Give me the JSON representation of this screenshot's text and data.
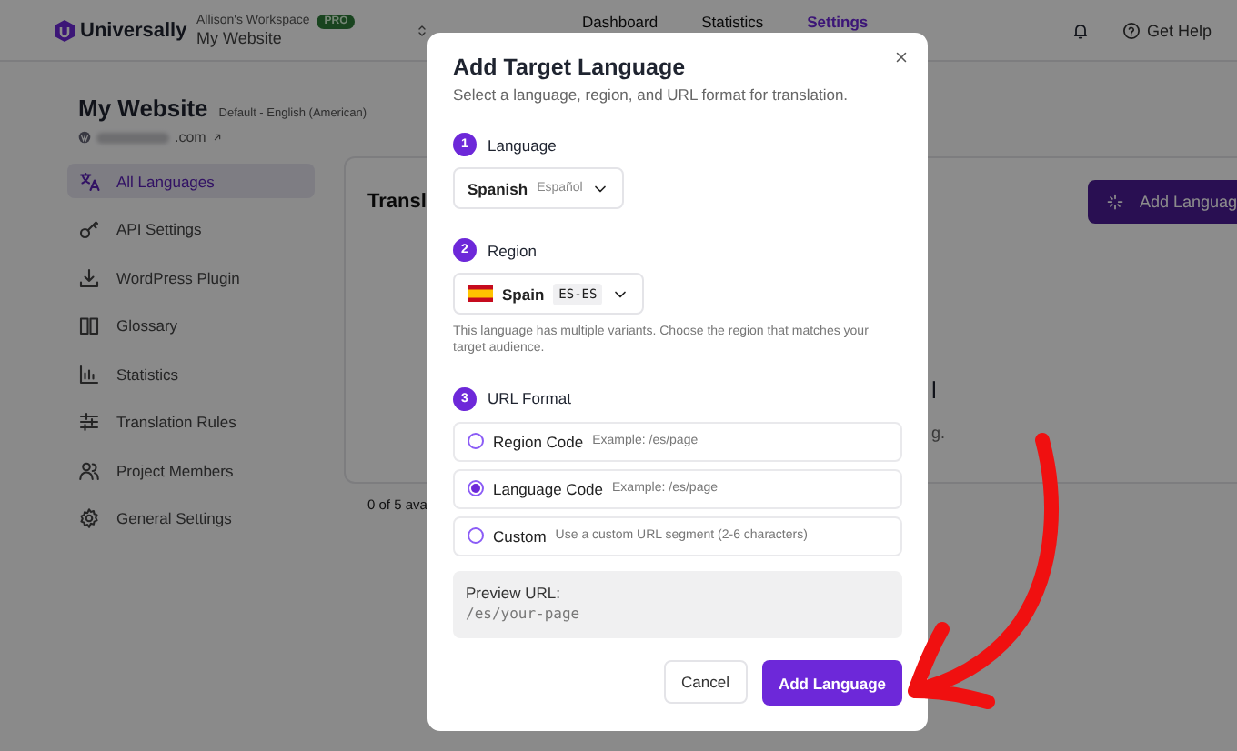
{
  "header": {
    "brand": "Universally",
    "workspace": "Allison's Workspace",
    "badge": "PRO",
    "site": "My Website",
    "help": "Get Help",
    "nav": [
      {
        "label": "Dashboard",
        "selected": false
      },
      {
        "label": "Statistics",
        "selected": false
      },
      {
        "label": "Settings",
        "selected": true
      }
    ]
  },
  "site": {
    "title": "My Website",
    "default_language": "Default - English (American)",
    "domain": ".com"
  },
  "sidebar": {
    "items": [
      {
        "label": "All Languages",
        "selected": true
      },
      {
        "label": "API Settings",
        "selected": false
      },
      {
        "label": "WordPress Plugin",
        "selected": false
      },
      {
        "label": "Glossary",
        "selected": false
      },
      {
        "label": "Statistics",
        "selected": false
      },
      {
        "label": "Translation Rules",
        "selected": false
      },
      {
        "label": "Project Members",
        "selected": false
      },
      {
        "label": "General Settings",
        "selected": false
      }
    ]
  },
  "main": {
    "card_title": "Transl",
    "add_button": "Add Languag",
    "empty_title": "l",
    "empty_text": "g.",
    "count": "0 of 5 ava"
  },
  "dialog": {
    "title": "Add Target Language",
    "subtitle": "Select a language, region, and URL format for translation.",
    "language": {
      "step": "1",
      "label": "Language",
      "value": "Spanish",
      "native": "Español"
    },
    "region": {
      "step": "2",
      "label": "Region",
      "value": "Spain",
      "code": "ES-ES",
      "hint": "This language has multiple variants. Choose the region that matches your target audience."
    },
    "url_format": {
      "step": "3",
      "label": "URL Format",
      "options": [
        {
          "label": "Region Code",
          "example": "Example: /es/page",
          "selected": false
        },
        {
          "label": "Language Code",
          "example": "Example: /es/page",
          "selected": true
        },
        {
          "label": "Custom",
          "example": "Use a custom URL segment (2-6 characters)",
          "selected": false
        }
      ]
    },
    "preview": {
      "label": "Preview URL:",
      "value": "/es/your-page"
    },
    "buttons": {
      "cancel": "Cancel",
      "confirm": "Add Language"
    }
  }
}
